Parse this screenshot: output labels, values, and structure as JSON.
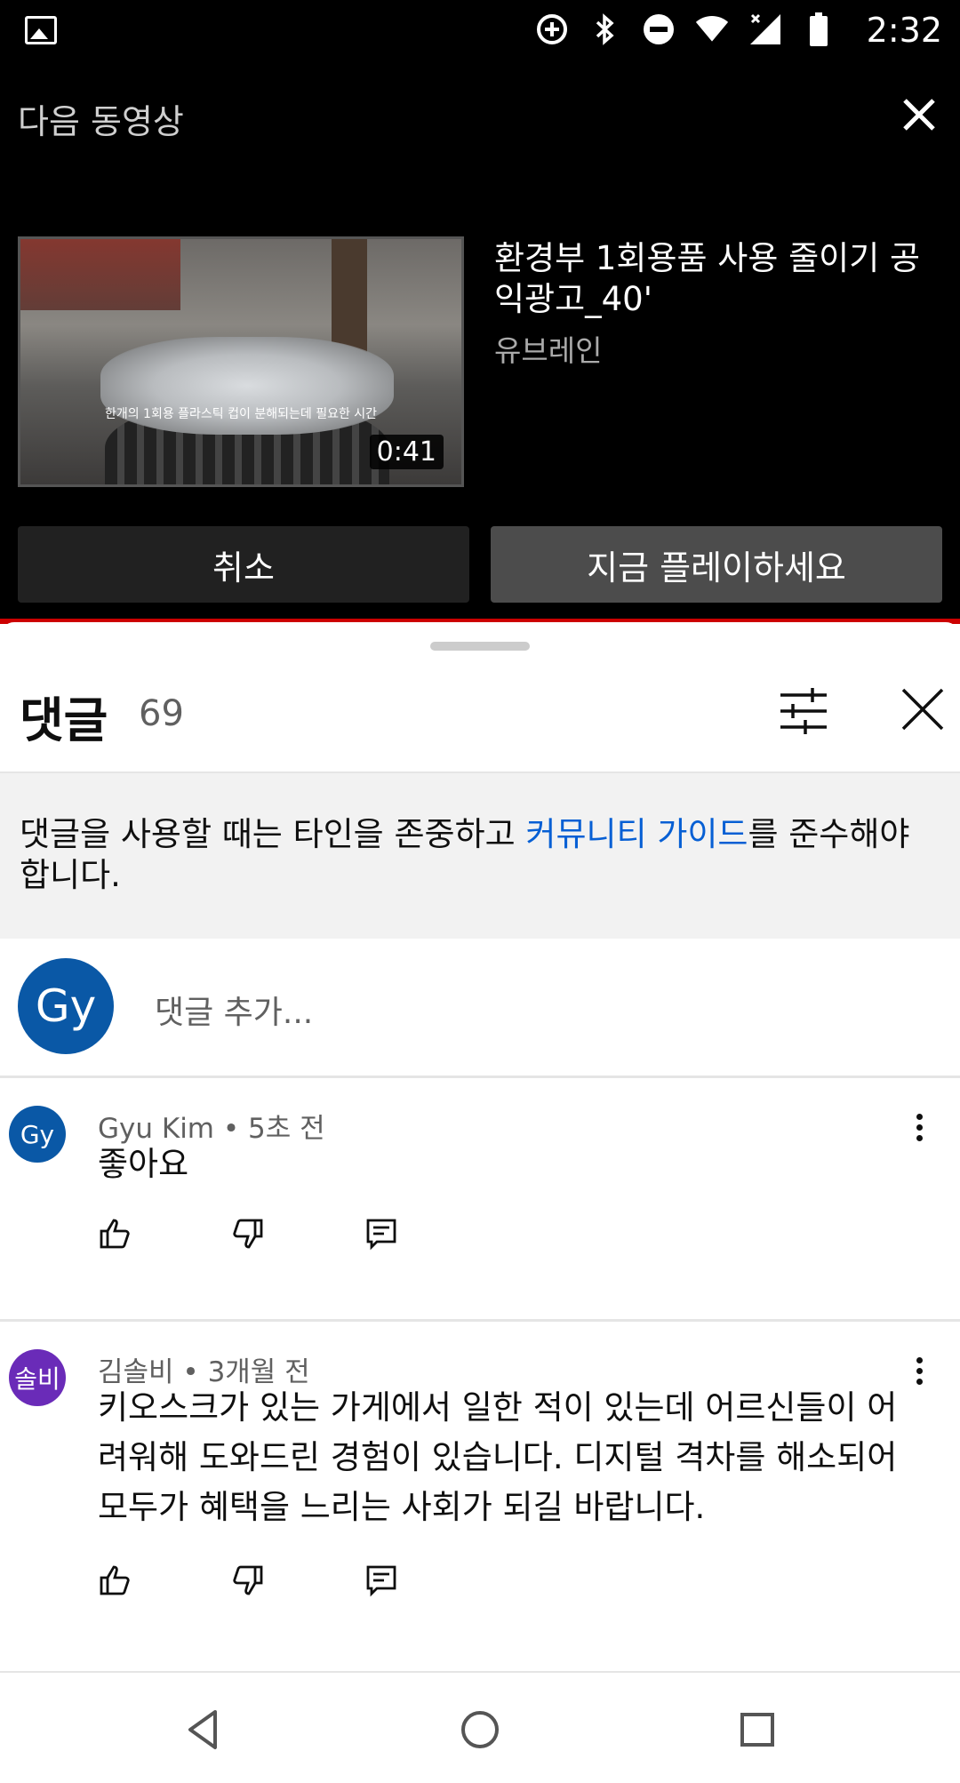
{
  "status_bar": {
    "time": "2:32",
    "icons": [
      "gallery-icon",
      "data-saver-icon",
      "bluetooth-icon",
      "do-not-disturb-icon",
      "wifi-icon",
      "signal-icon",
      "battery-icon"
    ]
  },
  "up_next": {
    "label": "다음 동영상",
    "thumbnail_caption": "한개의 1회용 플라스틱 컵이 분해되는데 필요한 시간",
    "duration": "0:41",
    "title": "환경부 1회용품 사용 줄이기 공익광고_40'",
    "channel": "유브레인",
    "cancel_label": "취소",
    "play_label": "지금 플레이하세요",
    "accent_color": "#cc0000"
  },
  "comments": {
    "heading": "댓글",
    "count": "69",
    "guideline": {
      "prefix": "댓글을 사용할 때는 타인을 존중하고 ",
      "link": "커뮤니티 가이드",
      "suffix": "를 준수해야 합니다."
    },
    "add": {
      "avatar_text": "Gy",
      "placeholder": "댓글 추가..."
    },
    "items": [
      {
        "avatar_text": "Gy",
        "avatar_color": "#0a58a6",
        "author": "Gyu Kim",
        "time": "5초 전",
        "text": "좋아요"
      },
      {
        "avatar_text": "솔비",
        "avatar_color": "#6a2bb8",
        "author": "김솔비",
        "time": "3개월 전",
        "text": "키오스크가 있는 가게에서 일한 적이 있는데 어르신들이 어려워해 도와드린 경험이 있습니다. 디지털 격차를 해소되어 모두가 혜택을 느리는 사회가 되길 바랍니다."
      }
    ]
  }
}
